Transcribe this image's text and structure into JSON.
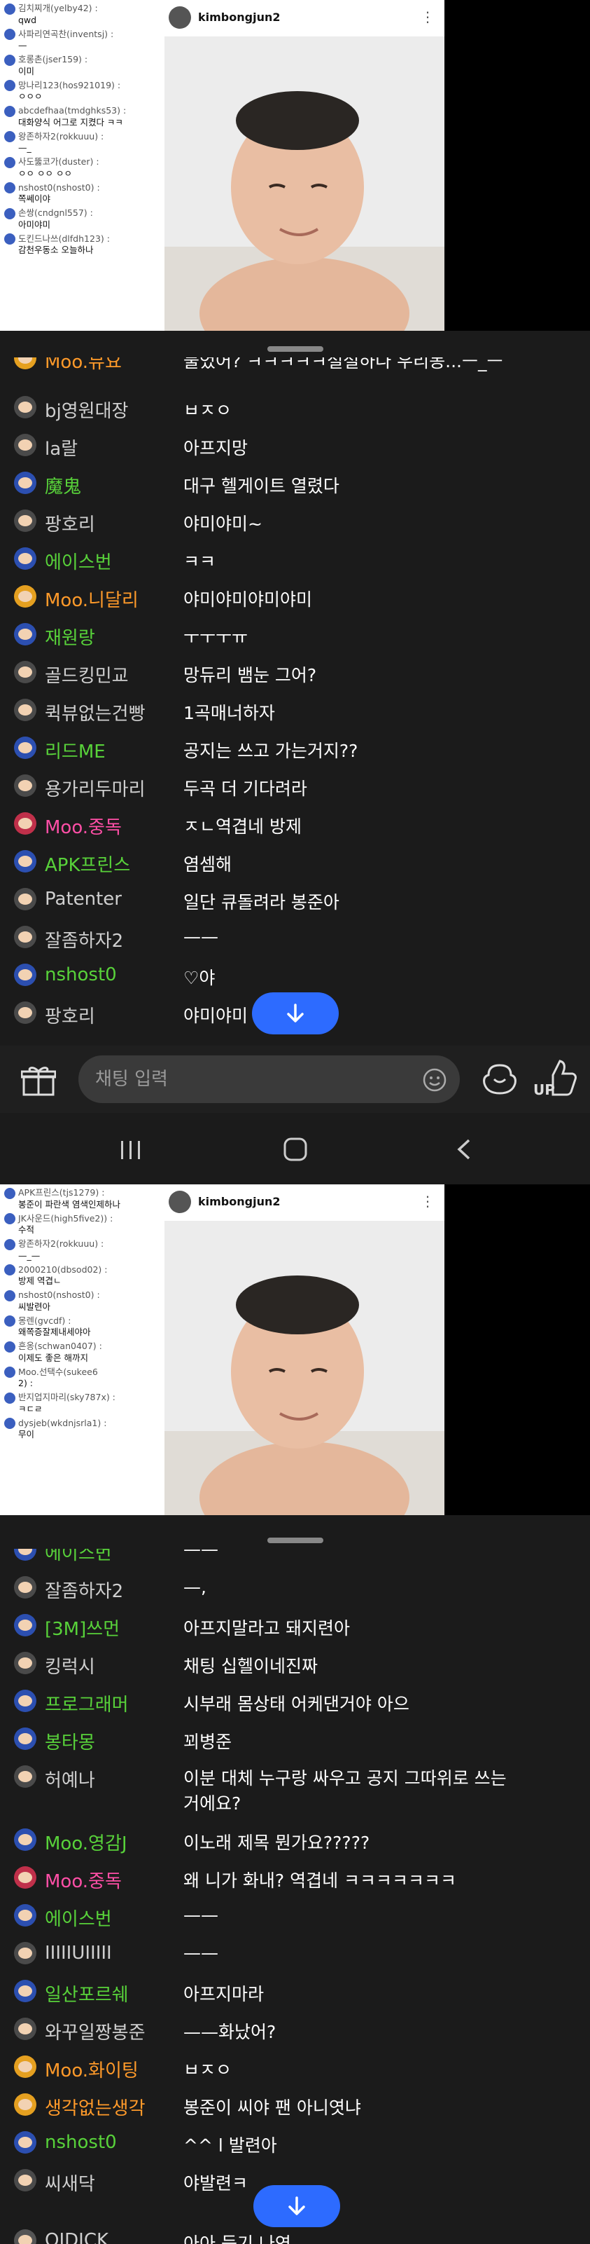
{
  "streamer": "kimbongjun2",
  "input": {
    "placeholder": "채팅 입력"
  },
  "colors": {
    "background": "#1b1b1b",
    "fab": "#2d6bff",
    "green": "#58d23a",
    "orange": "#ff9a2a",
    "pink": "#ff4fa6",
    "gray": "#cfcfcf"
  },
  "icons": [
    "gift-icon",
    "smile-icon",
    "emote-icon",
    "thumbs-up-icon",
    "arrow-down-icon",
    "nav-recent-icon",
    "nav-home-icon",
    "nav-back-icon"
  ],
  "screen1": {
    "mini_chat": [
      {
        "nick": "김치찌개(yelby42) :",
        "text": "qwd"
      },
      {
        "nick": "사파리연곡찬(inventsj) :",
        "text": "—"
      },
      {
        "nick": "호롱촌(jser159) :",
        "text": "이미"
      },
      {
        "nick": "망나리123(hos921019) :",
        "text": "ㅇㅇㅇ"
      },
      {
        "nick": "abcdefhaa(tmdghks53) :",
        "text": "대화양식 어그로 지켰다 ㅋㅋ"
      },
      {
        "nick": "왕존하자2(rokkuuu) :",
        "text": "—_"
      },
      {
        "nick": "사도뚫코가(duster) :",
        "text": "ㅇㅇ ㅇㅇ ㅇㅇ"
      },
      {
        "nick": "nshost0(nshost0) :",
        "text": "쪽쎄이야"
      },
      {
        "nick": "손쌍(cndgnl557) :",
        "text": "아미야미"
      },
      {
        "nick": "도킨드나쓰(dlfdh123) :",
        "text": "감천우동소 오늘하나"
      }
    ],
    "top_partial": {
      "nick": "Moo.뮤요",
      "msg": "물었어? ㅋㅋㅋㅋㅋ설설하나 우리동...ㅡ_ㅡ"
    },
    "rows": [
      {
        "nick": "bj영원대장",
        "msg": "ㅂㅈㅇ",
        "color": "gray"
      },
      {
        "nick": "la랄",
        "msg": "아프지망",
        "color": "gray"
      },
      {
        "nick": "魔鬼",
        "msg": "대구 헬게이트 열렸다",
        "color": "green"
      },
      {
        "nick": "팡호리",
        "msg": "야미야미~",
        "color": "gray"
      },
      {
        "nick": "에이스번",
        "msg": "ㅋㅋ",
        "color": "green"
      },
      {
        "nick": "Moo.니달리",
        "msg": "야미야미야미야미",
        "color": "orange"
      },
      {
        "nick": "재원랑",
        "msg": "ㅜㅜㅜㅠ",
        "color": "green"
      },
      {
        "nick": "골드킹민교",
        "msg": "망듀리 뱀눈 그어?",
        "color": "gray"
      },
      {
        "nick": "퀵뷰없는건빵",
        "msg": "1곡매너하자",
        "color": "gray"
      },
      {
        "nick": "리드ME",
        "msg": "공지는 쓰고 가는거지??",
        "color": "green"
      },
      {
        "nick": "용가리두마리",
        "msg": "두곡 더 기다려라",
        "color": "gray"
      },
      {
        "nick": "Moo.중독",
        "msg": "ㅈㄴ역겹네 방제",
        "color": "pink"
      },
      {
        "nick": "APK프린스",
        "msg": "염셈해",
        "color": "green"
      },
      {
        "nick": "Patenter",
        "msg": "일단 큐돌려라 봉준아",
        "color": "gray"
      },
      {
        "nick": "잘좀하자2",
        "msg": "——",
        "color": "gray"
      },
      {
        "nick": "nshost0",
        "msg": "♡야",
        "color": "green"
      },
      {
        "nick": "팡호리",
        "msg": "야미야미",
        "color": "gray"
      }
    ]
  },
  "screen2": {
    "mini_chat": [
      {
        "nick": "APK프린스(tjs1279) :",
        "text": "봉준이 파란색 염색인제하나"
      },
      {
        "nick": "JK사운드(high5five2)) :",
        "text": "수적"
      },
      {
        "nick": "왕존하자2(rokkuuu) :",
        "text": "—_—"
      },
      {
        "nick": "2000210(dbsod02) :",
        "text": "방제 역겹ㄴ"
      },
      {
        "nick": "nshost0(nshost0) :",
        "text": "씨발련아"
      },
      {
        "nick": "몽렌(gvcdf) :",
        "text": "왜쪽증잘제내세야아"
      },
      {
        "nick": "흔옹(schwan0407) :",
        "text": "이제도 좋은 해까지"
      },
      {
        "nick": "Moo.선택수(sukee6",
        "text": "2) :"
      },
      {
        "nick": "반지업지마리(sky787x) :",
        "text": "ㅋㄷㄹ"
      },
      {
        "nick": "dysjeb(wkdnjsrla1) :",
        "text": "무이"
      }
    ],
    "top_partial": {
      "nick": "에이스번",
      "msg": "——"
    },
    "rows": [
      {
        "nick": "잘좀하자2",
        "msg": "—,",
        "color": "gray"
      },
      {
        "nick": "[3M]쓰먼",
        "msg": "아프지말라고 돼지련아",
        "color": "green"
      },
      {
        "nick": "킹럭시",
        "msg": "채팅 십헬이네진짜",
        "color": "gray"
      },
      {
        "nick": "프로그래머",
        "msg": "시부래 몸상태 어케댄거야 아으",
        "color": "green"
      },
      {
        "nick": "봉타몽",
        "msg": "꾀병준",
        "color": "green"
      },
      {
        "nick": "허예나",
        "msg": "이분 대체 누구랑 싸우고 공지 그따위로 쓰는거에요?",
        "color": "gray",
        "tall": true
      },
      {
        "nick": "Moo.영감J",
        "msg": "이노래 제목 뭔가요?????",
        "color": "green"
      },
      {
        "nick": "Moo.중독",
        "msg": "왜 니가 화내? 역겹네 ㅋㅋㅋㅋㅋㅋㅋ",
        "color": "pink"
      },
      {
        "nick": "에이스번",
        "msg": "——",
        "color": "green"
      },
      {
        "nick": "IIIIIUIIIII",
        "msg": "——",
        "color": "gray"
      },
      {
        "nick": "일산포르쉐",
        "msg": "아프지마라",
        "color": "green"
      },
      {
        "nick": "와꾸일짱봉준",
        "msg": "——화났어?",
        "color": "gray"
      },
      {
        "nick": "Moo.화이팅",
        "msg": "ㅂㅈㅇ",
        "color": "orange"
      },
      {
        "nick": "생각없는생각",
        "msg": "봉준이 씨야 팬 아니엿냐",
        "color": "orange"
      },
      {
        "nick": "nshost0",
        "msg": "^^ l 발련아",
        "color": "green"
      },
      {
        "nick": "씨새닥",
        "msg": "야발련ㅋ",
        "color": "gray"
      }
    ],
    "bottom_partial": {
      "nick": "OIDICK",
      "msg": "아아 듣기 나연"
    }
  }
}
